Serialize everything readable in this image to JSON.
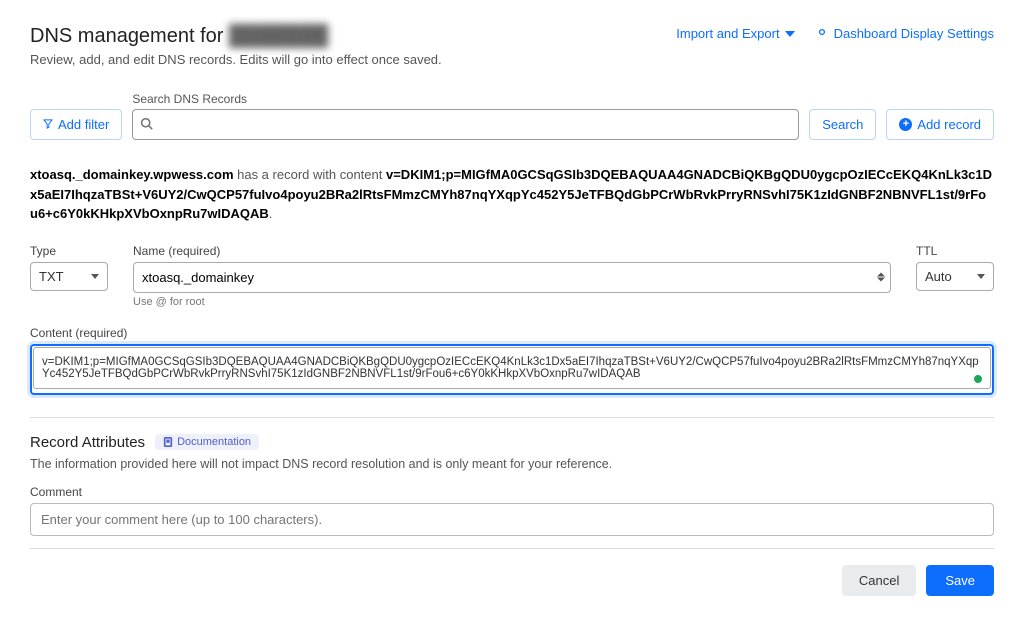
{
  "header": {
    "title_prefix": "DNS management for ",
    "title_domain": "███████",
    "subtitle": "Review, add, and edit DNS records. Edits will go into effect once saved.",
    "import_export": "Import and Export",
    "dashboard_settings": "Dashboard Display Settings"
  },
  "toolbar": {
    "add_filter": "Add filter",
    "search_label": "Search DNS Records",
    "search_placeholder": "",
    "search_button": "Search",
    "add_record": "Add record"
  },
  "record_summary": {
    "hostname": "xtoasq._domainkey.wpwess.com",
    "middle_text": " has a record with content ",
    "content": "v=DKIM1;p=MIGfMA0GCSqGSIb3DQEBAQUAA4GNADCBiQKBgQDU0ygcpOzIECcEKQ4KnLk3c1Dx5aEI7IhqzaTBSt+V6UY2/CwQCP57fuIvo4poyu2BRa2lRtsFMmzCMYh87nqYXqpYc452Y5JeTFBQdGbPCrWbRvkPrryRNSvhI75K1zIdGNBF2NBNVFL1st/9rFou6+c6Y0kKHkpXVbOxnpRu7wIDAQAB"
  },
  "form": {
    "type_label": "Type",
    "type_value": "TXT",
    "name_label": "Name (required)",
    "name_value": "xtoasq._domainkey",
    "name_hint": "Use @ for root",
    "ttl_label": "TTL",
    "ttl_value": "Auto",
    "content_label": "Content (required)",
    "content_value": "v=DKIM1;p=MIGfMA0GCSqGSIb3DQEBAQUAA4GNADCBiQKBgQDU0ygcpOzIECcEKQ4KnLk3c1Dx5aEI7IhqzaTBSt+V6UY2/CwQCP57fuIvo4poyu2BRa2lRtsFMmzCMYh87nqYXqpYc452Y5JeTFBQdGbPCrWbRvkPrryRNSvhI75K1zIdGNBF2NBNVFL1st/9rFou6+c6Y0kKHkpXVbOxnpRu7wIDAQAB"
  },
  "attributes": {
    "heading": "Record Attributes",
    "doc_link": "Documentation",
    "description": "The information provided here will not impact DNS record resolution and is only meant for your reference.",
    "comment_label": "Comment",
    "comment_placeholder": "Enter your comment here (up to 100 characters)."
  },
  "footer": {
    "cancel": "Cancel",
    "save": "Save"
  }
}
